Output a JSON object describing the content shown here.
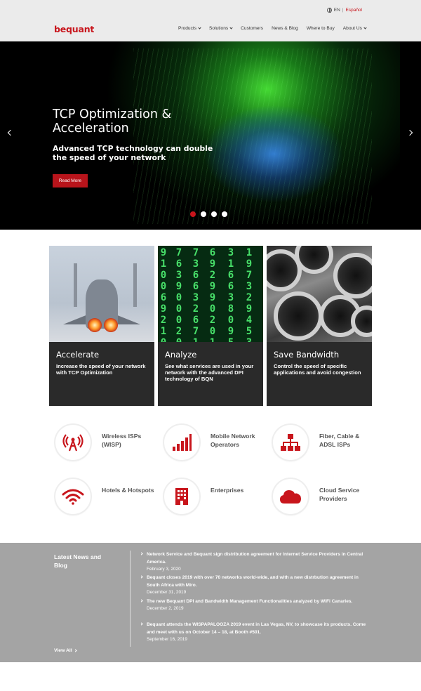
{
  "header": {
    "lang_en": "EN",
    "lang_sep": "|",
    "lang_es": "Español",
    "logo": "bequant",
    "nav": [
      {
        "label": "Products",
        "dropdown": true
      },
      {
        "label": "Solutions",
        "dropdown": true
      },
      {
        "label": "Customers",
        "dropdown": false
      },
      {
        "label": "News & Blog",
        "dropdown": false
      },
      {
        "label": "Where to Buy",
        "dropdown": false
      },
      {
        "label": "About Us",
        "dropdown": true
      }
    ]
  },
  "hero": {
    "title": "TCP Optimization & Acceleration",
    "subtitle": "Advanced TCP technology can double the speed of your network",
    "button": "Read More",
    "slides": 4,
    "active_slide": 1
  },
  "features": [
    {
      "title": "Accelerate",
      "description": "Increase the speed of your network with TCP Optimization"
    },
    {
      "title": "Analyze",
      "description": "See what services are used in your network with the advanced DPI technology of BQN"
    },
    {
      "title": "Save Bandwidth",
      "description": "Control the speed of specific applications and avoid congestion"
    }
  ],
  "matrix_columns": [
    "9\n1\n0\n0\n6\n9\n2\n1\n0",
    "7\n6\n3\n9\n0\n0\n0\n2\n0",
    "7\n3\n6\n6\n3\n2\n6\n7\n1",
    "6\n9\n2\n9\n9\n0\n2\n0\n1",
    "3\n1\n6\n6\n3\n8\n0\n9\n5",
    "1\n9\n7\n3\n2\n9\n4\n5\n3"
  ],
  "markets": [
    {
      "label": "Wireless ISPs (WISP)",
      "icon": "antenna-icon"
    },
    {
      "label": "Mobile Network Operators",
      "icon": "signal-bars-icon"
    },
    {
      "label": "Fiber, Cable & ADSL ISPs",
      "icon": "network-hierarchy-icon"
    },
    {
      "label": "Hotels & Hotspots",
      "icon": "wifi-icon"
    },
    {
      "label": "Enterprises",
      "icon": "building-icon"
    },
    {
      "label": "Cloud Service Providers",
      "icon": "cloud-icon"
    }
  ],
  "news": {
    "heading": "Latest News and Blog",
    "view_all": "View All",
    "items": [
      {
        "title": "Network Service and Bequant sign distribution agreement for Internet Service Providers in Central America.",
        "date": "February 3, 2020"
      },
      {
        "title": "Bequant closes 2019 with over 70 networks world-wide, and with a new distrbution agreement in South Africa with Miro.",
        "date": "December 31, 2019"
      },
      {
        "title": "The new Bequant DPI and Bandwidth Management Functionalities analyzed by WiFi Canaries.",
        "date": "December 2, 2019"
      },
      {
        "title": "Bequant attends the WISPAPALOOZA 2019 event in Las Vegas, NV, to showcase its products. Come and meet with us on October 14 – 18, at Booth #501.",
        "date": "September 16, 2019"
      }
    ]
  },
  "colors": {
    "brand_red": "#c8151c",
    "header_bg": "#ebebeb",
    "news_bg": "#a4a4a4"
  }
}
